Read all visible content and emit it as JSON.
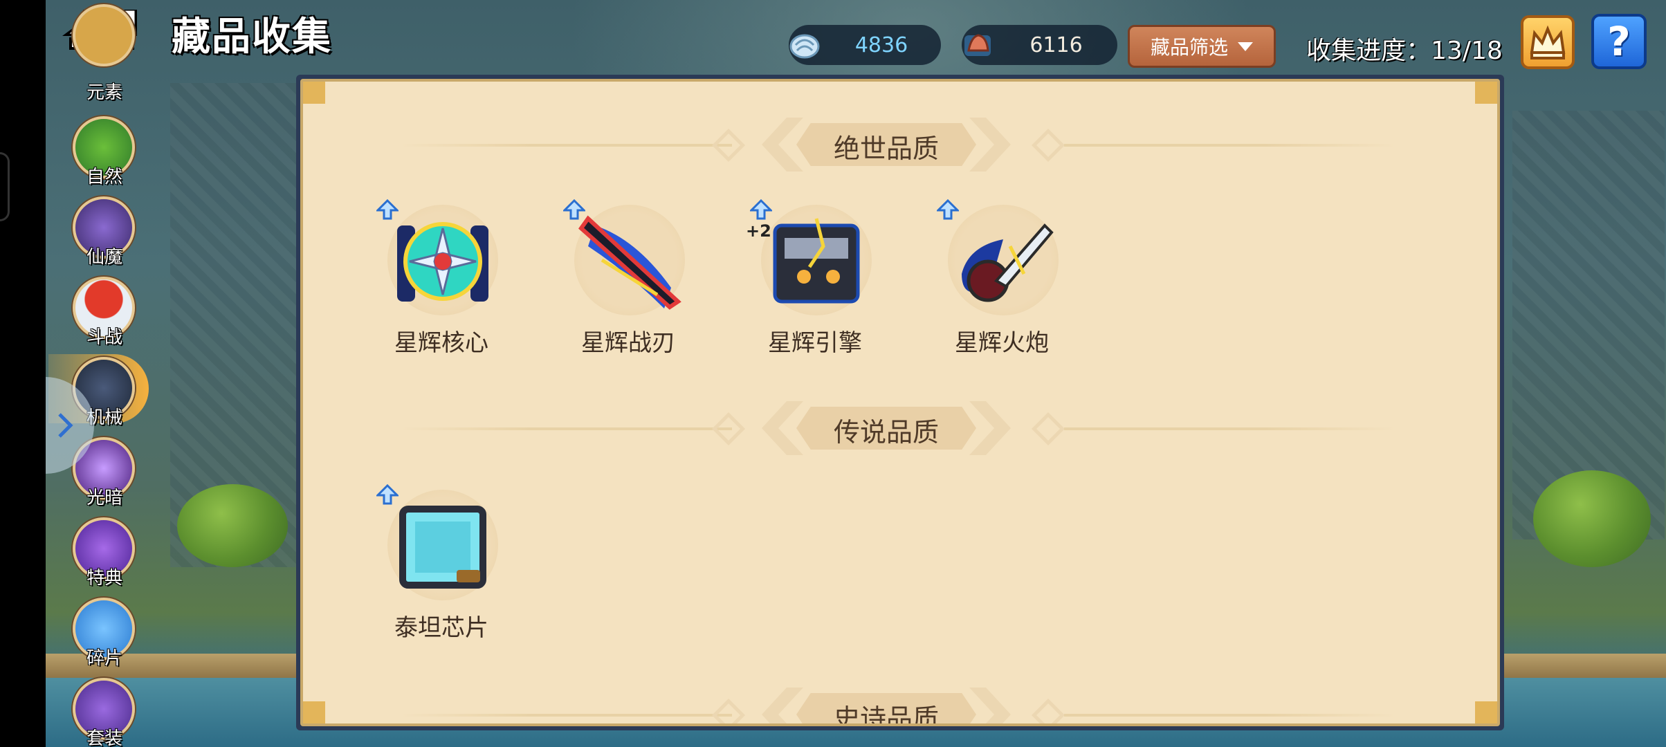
{
  "header": {
    "title": "藏品收集",
    "currencies": [
      {
        "icon": "shell-currency-icon",
        "value": "4836"
      },
      {
        "icon": "ore-currency-icon",
        "value": "6116"
      }
    ],
    "filter_label": "藏品筛选",
    "progress_text": "收集进度：13/18"
  },
  "sidebar": {
    "items": [
      {
        "label": "元素"
      },
      {
        "label": "自然"
      },
      {
        "label": "仙魔"
      },
      {
        "label": "斗战"
      },
      {
        "label": "机械",
        "active": true
      },
      {
        "label": "光暗"
      },
      {
        "label": "特典"
      },
      {
        "label": "碎片"
      },
      {
        "label": "套装"
      }
    ]
  },
  "sections": [
    {
      "title": "绝世品质",
      "items": [
        {
          "name": "星辉核心",
          "upgradable": true
        },
        {
          "name": "星辉战刃",
          "upgradable": true
        },
        {
          "name": "星辉引擎",
          "upgradable": true,
          "bonus": "+2"
        },
        {
          "name": "星辉火炮",
          "upgradable": true
        }
      ]
    },
    {
      "title": "传说品质",
      "items": [
        {
          "name": "泰坦芯片",
          "upgradable": true
        }
      ]
    },
    {
      "title": "史诗品质",
      "items": []
    }
  ],
  "colors": {
    "panel_bg": "#f4e2c0",
    "filter_button": "#c2724a",
    "help_button": "#2f7fe8",
    "active_tab": "#f6b13e"
  }
}
